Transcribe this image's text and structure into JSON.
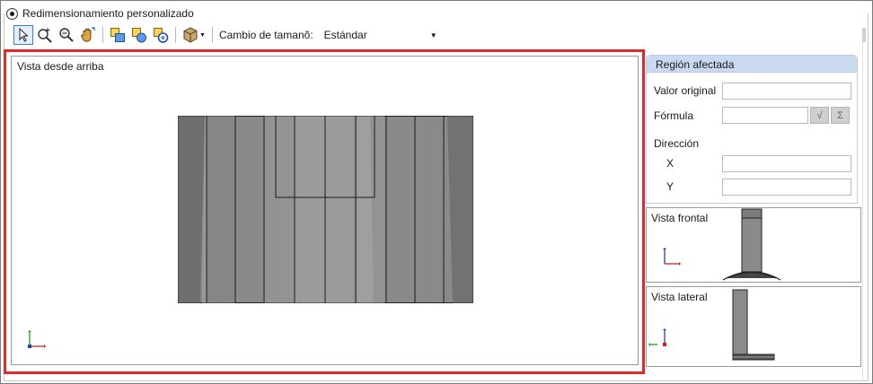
{
  "header": {
    "radio_label": "Redimensionamiento personalizado"
  },
  "toolbar": {
    "icons": [
      "select-arrow-icon",
      "zoom-window-icon",
      "zoom-icon",
      "pan-hand-icon",
      "shape-1-icon",
      "shape-2-icon",
      "shape-3-icon",
      "box-3d-icon"
    ],
    "resize_label": "Cambio de tamanõ:",
    "resize_value": "Estándar"
  },
  "main_view": {
    "title": "Vista desde arriba"
  },
  "region": {
    "title": "Región afectada",
    "original_label": "Valor original",
    "original_value": "",
    "formula_label": "Fórmula",
    "formula_value": "",
    "fx_symbol": "√",
    "sum_symbol": "Σ",
    "direction_label": "Dirección",
    "x_label": "X",
    "x_value": "",
    "y_label": "Y",
    "y_value": ""
  },
  "front_view": {
    "title": "Vista frontal"
  },
  "side_view": {
    "title": "Vista lateral"
  },
  "colors": {
    "highlight": "#e02a2a",
    "panel_header": "#c9daf0",
    "axis_x": "#d42020",
    "axis_y": "#22a022",
    "axis_z": "#1f3fcf"
  }
}
